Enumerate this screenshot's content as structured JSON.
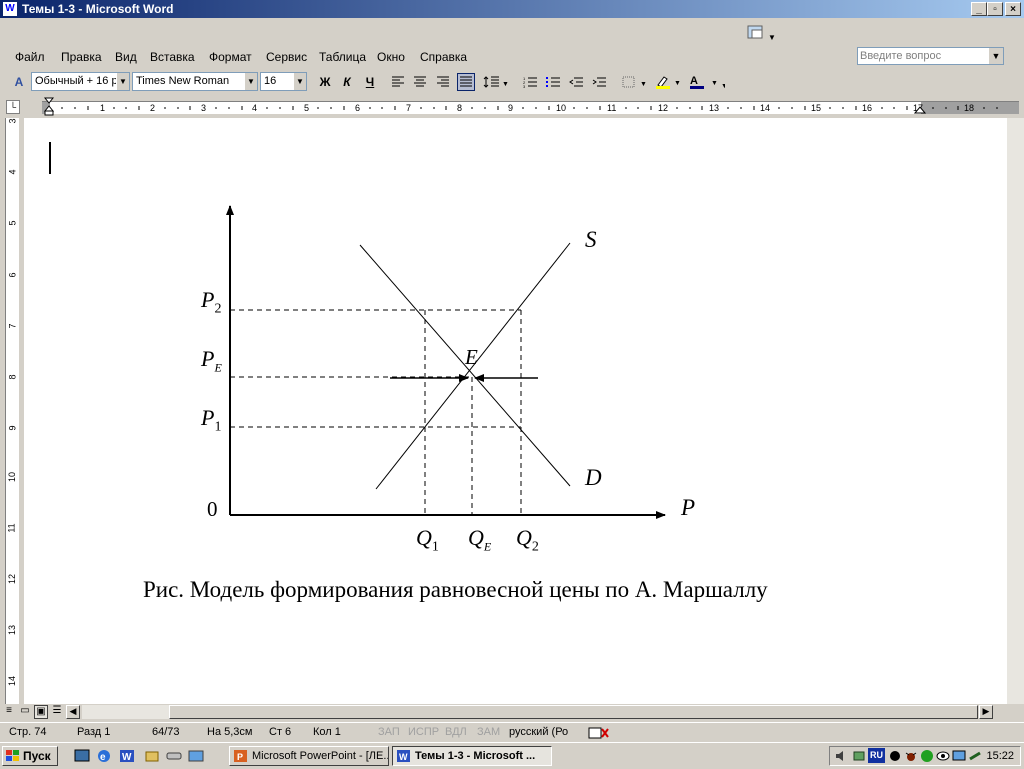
{
  "window": {
    "title": "Темы 1-3 - Microsoft Word",
    "min": "_",
    "restore": "▫",
    "close": "×"
  },
  "menu": {
    "items": [
      "Файл",
      "Правка",
      "Вид",
      "Вставка",
      "Формат",
      "Сервис",
      "Таблица",
      "Окно",
      "Справка"
    ],
    "ask_placeholder": "Введите вопрос"
  },
  "toolbar": {
    "style": "Обычный + 16 р",
    "font": "Times New Roman",
    "size": "16",
    "bold": "Ж",
    "italic": "К",
    "underline": "Ч"
  },
  "ruler": {
    "h_numbers": [
      "1",
      "1",
      "2",
      "3",
      "4",
      "5",
      "6",
      "7",
      "8",
      "9",
      "10",
      "11",
      "12",
      "13",
      "14",
      "15",
      "16",
      "17",
      "18"
    ],
    "v_numbers": [
      "3",
      "4",
      "5",
      "6",
      "7",
      "8",
      "9",
      "10",
      "11",
      "12",
      "13",
      "14"
    ]
  },
  "figure": {
    "y_labels": {
      "p2": "P",
      "p2_sub": "2",
      "pe": "P",
      "pe_sub": "E",
      "p1": "P",
      "p1_sub": "1",
      "zero": "0"
    },
    "x_axis_label": "P",
    "q_labels": {
      "q1": "Q",
      "q1_sub": "1",
      "qe": "Q",
      "qe_sub": "E",
      "q2": "Q",
      "q2_sub": "2"
    },
    "supply_label": "S",
    "demand_label": "D",
    "equilibrium_label": "E",
    "caption": "Рис. Модель формирования равновесной цены по А. Маршаллу"
  },
  "status": {
    "page": "Стр. 74",
    "section": "Разд 1",
    "pages": "64/73",
    "at": "На 5,3см",
    "line": "Ст 6",
    "col": "Кол 1",
    "rec": "ЗАП",
    "trk": "ИСПР",
    "ext": "ВДЛ",
    "ovr": "ЗАМ",
    "lang": "русский (Ро"
  },
  "taskbar": {
    "start": "Пуск",
    "tasks": [
      "Microsoft PowerPoint - [ЛЕ...",
      "Темы 1-3 - Microsoft ..."
    ],
    "lang_indicator": "RU",
    "clock": "15:22"
  }
}
